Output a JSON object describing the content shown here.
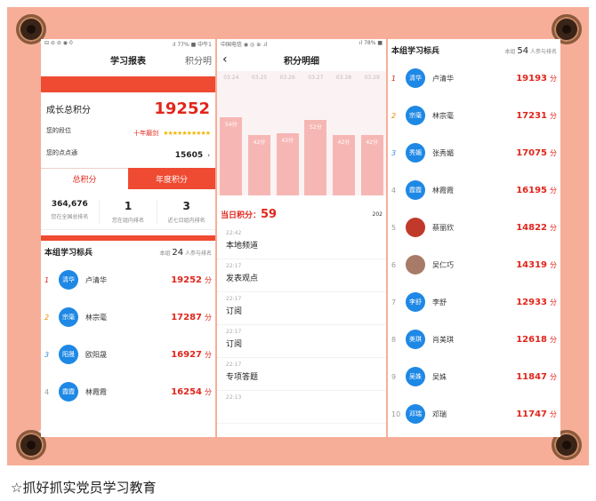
{
  "panel1": {
    "status": {
      "left": "⊟ ⊘ ⊘ ◉ 0",
      "right": "ıl 77% ■ 中午1"
    },
    "title": "学习报表",
    "right_tab": "积分明",
    "growth_label": "成长总积分",
    "growth_value": "19252",
    "level_label": "您的段位",
    "level_value": "十年磨剑",
    "stars": "★★★★★★★★★★",
    "points_label": "您的点点通",
    "points_value": "15605",
    "points_arrow": "›",
    "tab_total": "总积分",
    "tab_year": "年度积分",
    "stats": [
      {
        "num": "364,676",
        "label": "您在全国总排名"
      },
      {
        "num": "1",
        "label": "您在组内排名"
      },
      {
        "num": "3",
        "label": "近七日组内排名"
      }
    ],
    "section_title": "本组学习标兵",
    "section_meta_pre": "本组",
    "section_meta_count": "24",
    "section_meta_post": "人参与排名",
    "ranks": [
      {
        "idx": "1",
        "avatar": "清华",
        "name": "卢清华",
        "score": "19252",
        "unit": "分"
      },
      {
        "idx": "2",
        "avatar": "宗毫",
        "name": "林宗毫",
        "score": "17287",
        "unit": "分"
      },
      {
        "idx": "3",
        "avatar": "阳晟",
        "name": "欧阳晟",
        "score": "16927",
        "unit": "分"
      },
      {
        "idx": "4",
        "avatar": "霞霞",
        "name": "林霞霞",
        "score": "16254",
        "unit": "分"
      }
    ]
  },
  "panel2": {
    "status": {
      "left": "中国电信 ◉ ◎ ⊕ .ıl",
      "right": "ıl 78% ■"
    },
    "back": "‹",
    "title": "积分明细",
    "chart_data": {
      "type": "bar",
      "categories": [
        "03.24",
        "03.25",
        "03.26",
        "03.27",
        "03.28",
        "03.29"
      ],
      "values": [
        54,
        42,
        43,
        52,
        42,
        42
      ],
      "value_labels": [
        "54分",
        "42分",
        "43分",
        "52分",
        "42分",
        "42分"
      ],
      "ylim": [
        0,
        75
      ]
    },
    "today_label": "当日积分：",
    "today_value": "59",
    "year": "202",
    "logs": [
      {
        "time": "22:42",
        "desc": "本地频道"
      },
      {
        "time": "22:17",
        "desc": "发表观点"
      },
      {
        "time": "22:17",
        "desc": "订阅"
      },
      {
        "time": "22:17",
        "desc": "订阅"
      },
      {
        "time": "22:17",
        "desc": "专项答题"
      },
      {
        "time": "22:13",
        "desc": ""
      }
    ]
  },
  "panel3": {
    "section_title": "本组学习标兵",
    "section_meta_pre": "本组",
    "section_meta_count": "54",
    "section_meta_post": "人参与排名",
    "ranks": [
      {
        "idx": "1",
        "avatar": "清华",
        "name": "卢清华",
        "score": "19193",
        "unit": "分"
      },
      {
        "idx": "2",
        "avatar": "宗毫",
        "name": "林宗毫",
        "score": "17231",
        "unit": "分"
      },
      {
        "idx": "3",
        "avatar": "秀媚",
        "name": "张秀媚",
        "score": "17075",
        "unit": "分"
      },
      {
        "idx": "4",
        "avatar": "霞霞",
        "name": "林霞霞",
        "score": "16195",
        "unit": "分"
      },
      {
        "idx": "5",
        "avatar": "",
        "name": "蔡丽欣",
        "score": "14822",
        "unit": "分"
      },
      {
        "idx": "6",
        "avatar": "",
        "name": "吴仁巧",
        "score": "14319",
        "unit": "分"
      },
      {
        "idx": "7",
        "avatar": "李舒",
        "name": "李舒",
        "score": "12933",
        "unit": "分"
      },
      {
        "idx": "8",
        "avatar": "美琪",
        "name": "肖美琪",
        "score": "12618",
        "unit": "分"
      },
      {
        "idx": "9",
        "avatar": "吴姝",
        "name": "吴姝",
        "score": "11847",
        "unit": "分"
      },
      {
        "idx": "10",
        "avatar": "邓瑞",
        "name": "邓瑞",
        "score": "11747",
        "unit": "分"
      }
    ]
  },
  "caption": "☆抓好抓实党员学习教育",
  "colors": {
    "accent": "#ef4a32",
    "score": "#e1251b",
    "board": "#f7ae98",
    "avatar": "#1e88e5"
  }
}
